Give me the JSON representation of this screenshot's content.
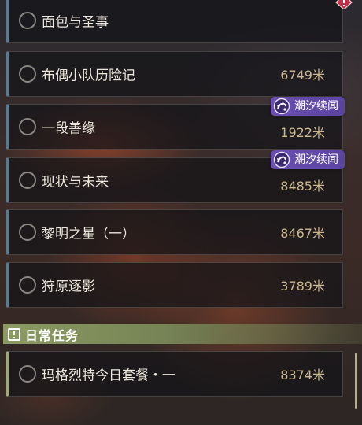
{
  "quests": [
    {
      "name": "面包与圣事",
      "distance": ""
    },
    {
      "name": "布偶小队历险记",
      "distance": "6749米"
    },
    {
      "name": "一段善缘",
      "distance": "1922米",
      "badge": "潮汐续闻"
    },
    {
      "name": "现状与未来",
      "distance": "8485米",
      "badge": "潮汐续闻"
    },
    {
      "name": "黎明之星（一）",
      "distance": "8467米"
    },
    {
      "name": "狩原逐影",
      "distance": "3789米"
    }
  ],
  "daily_section": {
    "title": "日常任务",
    "quests": [
      {
        "name": "玛格烈特今日套餐・一",
        "distance": "8374米"
      }
    ]
  },
  "colors": {
    "badge": "#6a4fb0",
    "daily_accent": "#8c9a62",
    "distance_text": "#cbb88e",
    "alert_icon": "#c0304a"
  },
  "icons": {
    "badge": "tidal-sequel-icon",
    "corner": "alert-icon",
    "section": "exclamation-icon"
  }
}
